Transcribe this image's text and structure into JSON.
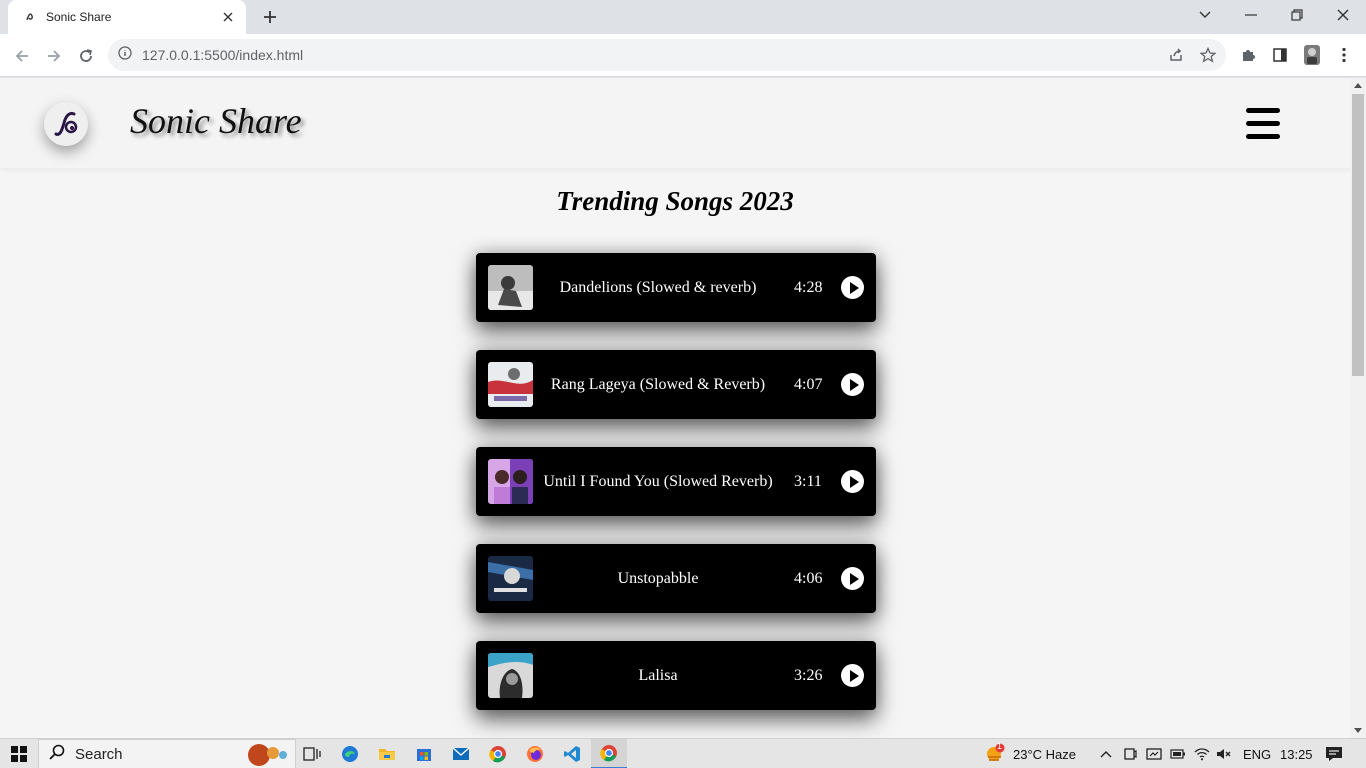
{
  "browser": {
    "tab_title": "Sonic Share",
    "url": "127.0.0.1:5500/index.html"
  },
  "site": {
    "brand": "Sonic Share",
    "section_title": "Trending Songs 2023"
  },
  "songs": [
    {
      "title": "Dandelions (Slowed & reverb)",
      "duration": "4:28",
      "cover_color": "#9a9a9a"
    },
    {
      "title": "Rang Lageya (Slowed & Reverb)",
      "duration": "4:07",
      "cover_color": "#c8323c"
    },
    {
      "title": "Until I Found You (Slowed Reverb)",
      "duration": "3:11",
      "cover_color": "#b04cc8"
    },
    {
      "title": "Unstopabble",
      "duration": "4:06",
      "cover_color": "#2f5a8a"
    },
    {
      "title": "Lalisa",
      "duration": "3:26",
      "cover_color": "#3ba3c8"
    }
  ],
  "taskbar": {
    "search_label": "Search",
    "weather": "23°C  Haze",
    "weather_badge": "1",
    "language": "ENG",
    "time": "13:25"
  }
}
